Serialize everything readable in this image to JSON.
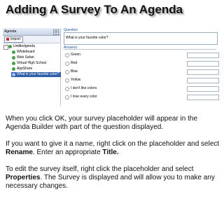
{
  "slide_title": "Adding A Survey To An Agenda",
  "screenshot": {
    "left_panel": {
      "title": "Agenda",
      "close_label": "x",
      "import_label": "Import",
      "collapse_label": "-",
      "tree": [
        {
          "label": "Untitledgenda",
          "type": "root"
        },
        {
          "label": "Whiteboard",
          "type": "child"
        },
        {
          "label": "Web Safari",
          "type": "child"
        },
        {
          "label": "Virtual High School",
          "type": "child"
        },
        {
          "label": "AppShare",
          "type": "child"
        },
        {
          "label": "What is your favorite color?",
          "type": "child",
          "selected": true
        }
      ]
    },
    "right_panel": {
      "question_label": "Question",
      "question_text": "What is your favorite color?",
      "answers_label": "Answers",
      "answers": [
        "Green",
        "Red",
        "Blue",
        "Yellow",
        "I don't like colors",
        "I love every color"
      ]
    }
  },
  "paragraphs": {
    "p1": "When you click OK, your survey placeholder will appear in the Agenda Builder with part of the question displayed.",
    "p2_pre": "If you want to give it a name, right click on the placeholder and select ",
    "p2_b1": "Rename",
    "p2_mid": ". Enter an appropriate ",
    "p2_b2": "Title.",
    "p3_pre": "To edit the survey itself, right click the placeholder and select ",
    "p3_b1": "Properties",
    "p3_post": ". The Survey is displayed and will allow you to make any necessary changes."
  }
}
